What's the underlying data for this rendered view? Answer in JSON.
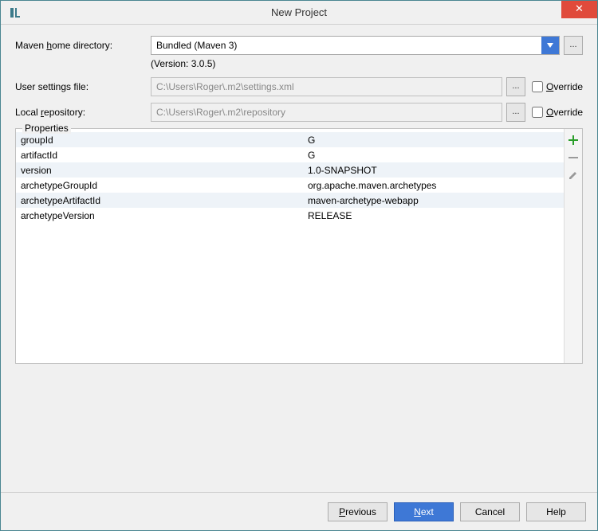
{
  "title": "New Project",
  "labels": {
    "mavenHome": "Maven home directory:",
    "mavenHome_u": "h",
    "userSettings": "User settings file:",
    "localRepo": "Local repository:",
    "localRepo_u": "r",
    "override": "Override",
    "override_u": "O",
    "properties": "Properties"
  },
  "mavenHome": {
    "selected": "Bundled (Maven 3)",
    "versionNote": "(Version: 3.0.5)"
  },
  "userSettings": {
    "path": "C:\\Users\\Roger\\.m2\\settings.xml",
    "override": false
  },
  "localRepo": {
    "path": "C:\\Users\\Roger\\.m2\\repository",
    "override": false
  },
  "properties": [
    {
      "key": "groupId",
      "value": "G"
    },
    {
      "key": "artifactId",
      "value": "G"
    },
    {
      "key": "version",
      "value": "1.0-SNAPSHOT"
    },
    {
      "key": "archetypeGroupId",
      "value": "org.apache.maven.archetypes"
    },
    {
      "key": "archetypeArtifactId",
      "value": "maven-archetype-webapp"
    },
    {
      "key": "archetypeVersion",
      "value": "RELEASE"
    }
  ],
  "buttons": {
    "previous": "Previous",
    "previous_u": "P",
    "next": "Next",
    "next_u": "N",
    "cancel": "Cancel",
    "help": "Help"
  },
  "browse": "..."
}
